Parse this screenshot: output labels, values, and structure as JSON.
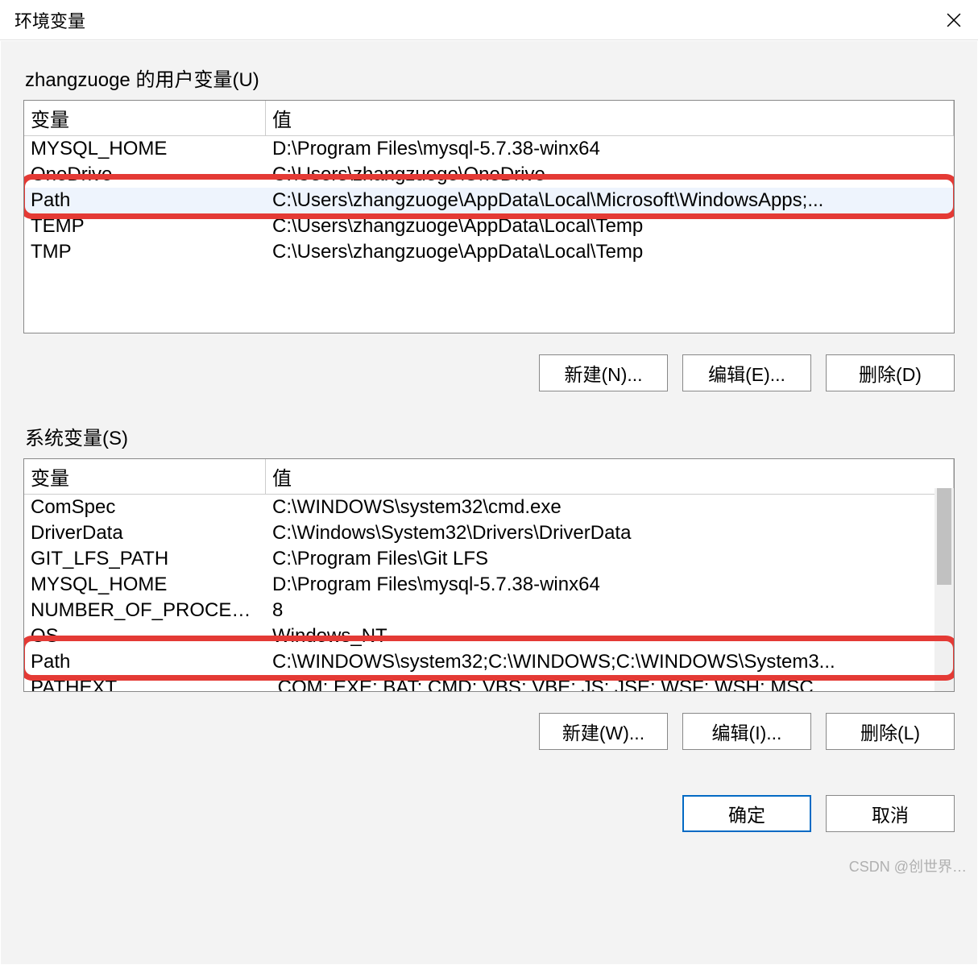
{
  "window": {
    "title": "环境变量",
    "close_icon": "close"
  },
  "user_section": {
    "label": "zhangzuoge 的用户变量(U)",
    "headers": {
      "var": "变量",
      "val": "值"
    },
    "rows": [
      {
        "var": "MYSQL_HOME",
        "val": "D:\\Program Files\\mysql-5.7.38-winx64"
      },
      {
        "var": "OneDrive",
        "val": "C:\\Users\\zhangzuoge\\OneDrive"
      },
      {
        "var": "Path",
        "val": "C:\\Users\\zhangzuoge\\AppData\\Local\\Microsoft\\WindowsApps;..."
      },
      {
        "var": "TEMP",
        "val": "C:\\Users\\zhangzuoge\\AppData\\Local\\Temp"
      },
      {
        "var": "TMP",
        "val": "C:\\Users\\zhangzuoge\\AppData\\Local\\Temp"
      }
    ],
    "selected_index": 2,
    "highlight_index": 2,
    "buttons": {
      "new": "新建(N)...",
      "edit": "编辑(E)...",
      "delete": "删除(D)"
    }
  },
  "system_section": {
    "label": "系统变量(S)",
    "headers": {
      "var": "变量",
      "val": "值"
    },
    "rows": [
      {
        "var": "ComSpec",
        "val": "C:\\WINDOWS\\system32\\cmd.exe"
      },
      {
        "var": "DriverData",
        "val": "C:\\Windows\\System32\\Drivers\\DriverData"
      },
      {
        "var": "GIT_LFS_PATH",
        "val": "C:\\Program Files\\Git LFS"
      },
      {
        "var": "MYSQL_HOME",
        "val": "D:\\Program Files\\mysql-5.7.38-winx64"
      },
      {
        "var": "NUMBER_OF_PROCESSORS",
        "val": "8"
      },
      {
        "var": "OS",
        "val": "Windows_NT"
      },
      {
        "var": "Path",
        "val": "C:\\WINDOWS\\system32;C:\\WINDOWS;C:\\WINDOWS\\System3..."
      },
      {
        "var": "PATHEXT",
        "val": ".COM;.EXE;.BAT;.CMD;.VBS;.VBE;.JS;.JSE;.WSF;.WSH;.MSC"
      }
    ],
    "highlight_index": 6,
    "buttons": {
      "new": "新建(W)...",
      "edit": "编辑(I)...",
      "delete": "删除(L)"
    }
  },
  "footer": {
    "ok": "确定",
    "cancel": "取消"
  },
  "watermark": "CSDN @创世界…"
}
